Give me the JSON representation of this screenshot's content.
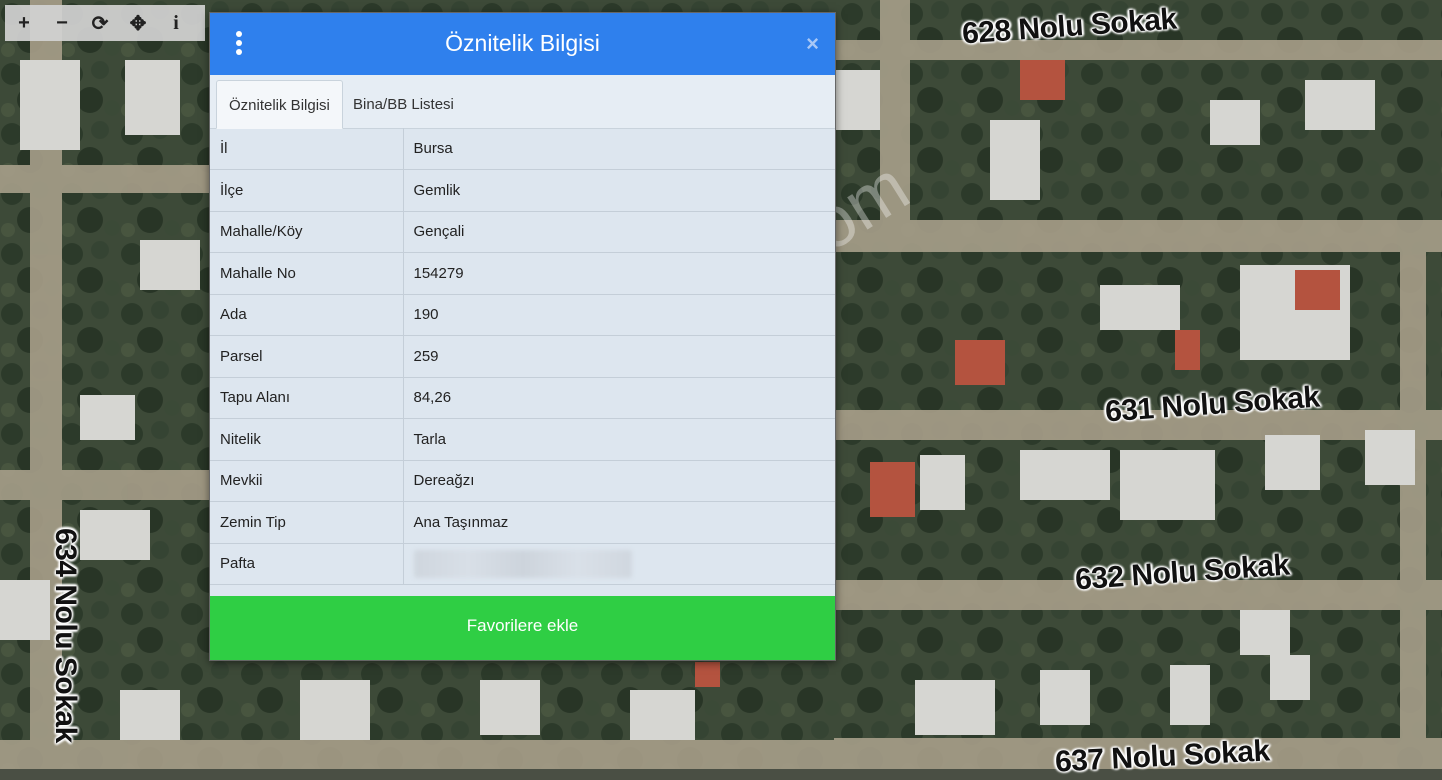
{
  "toolbar": {
    "buttons": [
      {
        "icon": "zoom-in-icon",
        "glyph": "+"
      },
      {
        "icon": "zoom-out-icon",
        "glyph": "−"
      },
      {
        "icon": "refresh-icon",
        "glyph": "⟳"
      },
      {
        "icon": "locate-icon",
        "glyph": "✥"
      },
      {
        "icon": "info-icon",
        "glyph": "i"
      }
    ]
  },
  "map": {
    "streets": {
      "s628": "628 Nolu Sokak",
      "s631": "631 Nolu Sokak",
      "s632": "632 Nolu Sokak",
      "s634": "634 Nolu Sokak",
      "s637": "637 Nolu Sokak"
    },
    "watermark": "emlakjet.com"
  },
  "dialog": {
    "title": "Öznitelik Bilgisi",
    "close_glyph": "×",
    "tabs": {
      "attributes": "Öznitelik Bilgisi",
      "buildings": "Bina/BB Listesi"
    },
    "rows": {
      "il": {
        "key": "İl",
        "value": "Bursa"
      },
      "ilce": {
        "key": "İlçe",
        "value": "Gemlik"
      },
      "mahalle": {
        "key": "Mahalle/Köy",
        "value": "Gençali"
      },
      "mahalle_no": {
        "key": "Mahalle No",
        "value": "154279"
      },
      "ada": {
        "key": "Ada",
        "value": "190"
      },
      "parsel": {
        "key": "Parsel",
        "value": "259"
      },
      "tapu_alani": {
        "key": "Tapu Alanı",
        "value": "84,26"
      },
      "nitelik": {
        "key": "Nitelik",
        "value": "Tarla"
      },
      "mevkii": {
        "key": "Mevkii",
        "value": "Dereağzı"
      },
      "zemin_tip": {
        "key": "Zemin Tip",
        "value": "Ana Taşınmaz"
      },
      "pafta": {
        "key": "Pafta"
      }
    },
    "favorite_button": "Favorilere ekle"
  },
  "colors": {
    "header": "#2f80ed",
    "favorite_button": "#2fce44",
    "panel": "#dde6ef"
  }
}
